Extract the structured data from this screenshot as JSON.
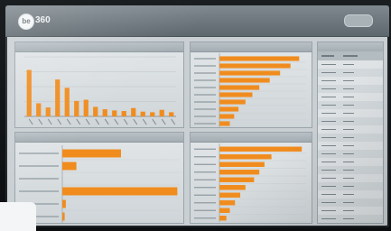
{
  "app": {
    "logo_text": "be",
    "brand": "360"
  },
  "colors": {
    "accent": "#f08c1e",
    "panel": "#d8dde0",
    "header": "#6e787e"
  },
  "panels": {
    "p1": {
      "title": ""
    },
    "p2": {
      "title": ""
    },
    "p3": {
      "title": ""
    },
    "p4": {
      "title": ""
    },
    "p5": {
      "title": ""
    }
  },
  "chart_data": [
    {
      "type": "bar",
      "orientation": "vertical",
      "categories": [],
      "values": [
        78,
        22,
        15,
        62,
        48,
        26,
        28,
        16,
        12,
        10,
        9,
        14,
        8,
        7,
        11,
        7
      ]
    },
    {
      "type": "bar",
      "orientation": "horizontal",
      "categories": [],
      "values": [
        92,
        82,
        70,
        58,
        46,
        38,
        30,
        22,
        17,
        12
      ]
    },
    {
      "type": "bar",
      "orientation": "horizontal",
      "categories": [],
      "values": [
        50,
        12,
        0,
        98,
        3,
        2
      ]
    },
    {
      "type": "bar",
      "orientation": "horizontal",
      "categories": [],
      "values": [
        95,
        60,
        52,
        46,
        40,
        30,
        24,
        18,
        12,
        8
      ]
    },
    {
      "type": "table",
      "columns": [],
      "rows": []
    }
  ]
}
